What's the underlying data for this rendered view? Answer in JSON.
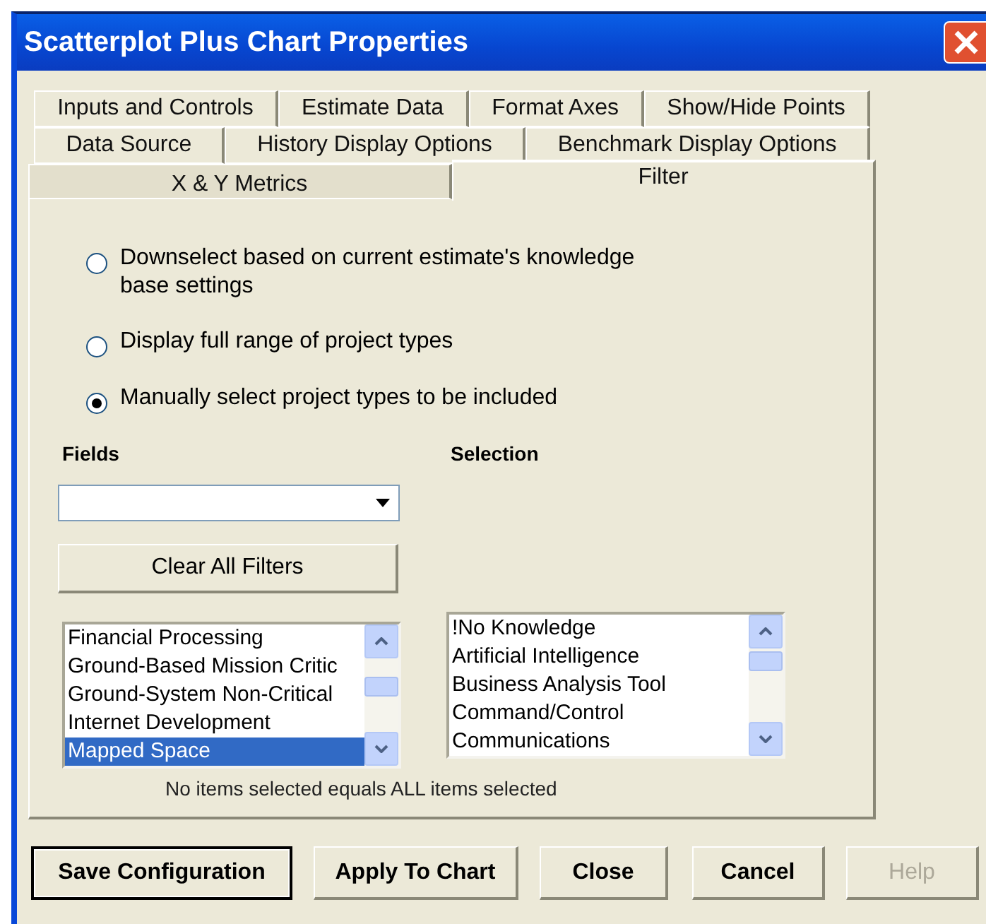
{
  "window": {
    "title": "Scatterplot Plus Chart Properties"
  },
  "tab_rows": [
    {
      "tabs": [
        {
          "label": "Inputs and Controls",
          "selected": false
        },
        {
          "label": "Estimate Data",
          "selected": false
        },
        {
          "label": "Format Axes",
          "selected": false
        },
        {
          "label": "Show/Hide Points",
          "selected": false
        }
      ]
    },
    {
      "tabs": [
        {
          "label": "Data Source",
          "selected": false
        },
        {
          "label": "History Display Options",
          "selected": false
        },
        {
          "label": "Benchmark Display Options",
          "selected": false
        }
      ]
    },
    {
      "tabs": [
        {
          "label": "X & Y Metrics",
          "selected": false
        },
        {
          "label": "Filter",
          "selected": true
        }
      ]
    }
  ],
  "filter_options": [
    {
      "label": "Downselect based on current estimate's knowledge base settings",
      "selected": false
    },
    {
      "label": "Display full range of project types",
      "selected": false
    },
    {
      "label": "Manually select project types to be included",
      "selected": true
    }
  ],
  "fields": {
    "label": "Fields",
    "list": [
      {
        "label": "Financial Processing",
        "selected": false
      },
      {
        "label": "Ground-Based Mission Critic",
        "selected": false
      },
      {
        "label": "Ground-System Non-Critical",
        "selected": false
      },
      {
        "label": "Internet Development",
        "selected": false
      },
      {
        "label": "Mapped Space",
        "selected": true
      }
    ]
  },
  "clear_button": "Clear All Filters",
  "selection": {
    "label": "Selection",
    "list": [
      {
        "label": "!No Knowledge",
        "selected": false
      },
      {
        "label": "Artificial Intelligence",
        "selected": false
      },
      {
        "label": "Business Analysis Tool",
        "selected": false
      },
      {
        "label": "Command/Control",
        "selected": false
      },
      {
        "label": "Communications",
        "selected": false
      }
    ]
  },
  "note": "No items selected equals ALL items selected",
  "buttons": [
    {
      "label": "Save Configuration",
      "default": true,
      "disabled": false
    },
    {
      "label": "Apply To Chart",
      "default": false,
      "disabled": false
    },
    {
      "label": "Close",
      "default": false,
      "disabled": false
    },
    {
      "label": "Cancel",
      "default": false,
      "disabled": false
    },
    {
      "label": "Help",
      "default": false,
      "disabled": true
    }
  ]
}
